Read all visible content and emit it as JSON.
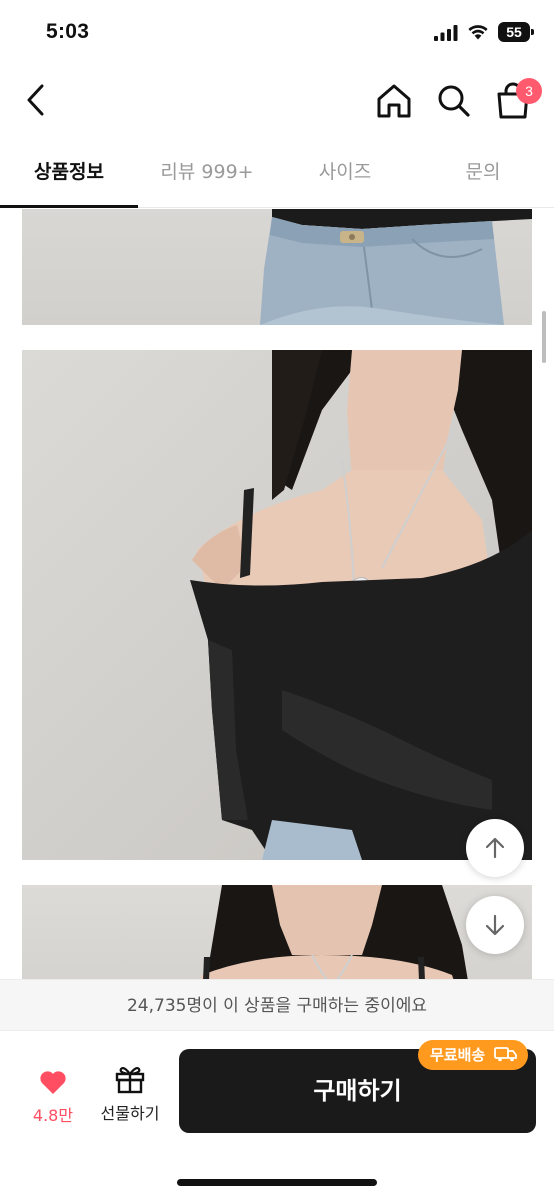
{
  "status_bar": {
    "time": "5:03",
    "battery": "55"
  },
  "header": {
    "back_icon": "chevron-left-icon",
    "home_icon": "home-icon",
    "search_icon": "search-icon",
    "cart_icon": "shopping-bag-icon",
    "cart_badge": "3",
    "badge_color": "#ff5a6e"
  },
  "tabs": [
    {
      "label": "상품정보",
      "active": true
    },
    {
      "label": "리뷰 999+",
      "active": false
    },
    {
      "label": "사이즈",
      "active": false
    },
    {
      "label": "문의",
      "active": false
    }
  ],
  "content": {
    "photos": [
      "product-photo-jeans-detail",
      "product-photo-off-shoulder-top",
      "product-photo-model"
    ],
    "scroll_up_icon": "arrow-up-icon",
    "scroll_down_icon": "arrow-down-icon"
  },
  "purchase_counter": "24,735명이 이 상품을 구매하는 중이에요",
  "bottom_bar": {
    "like_icon": "heart-icon",
    "like_count": "4.8만",
    "like_color": "#ff4d61",
    "gift_icon": "gift-icon",
    "gift_label": "선물하기",
    "buy_label": "구매하기",
    "shipping_badge": "무료배송",
    "shipping_icon": "truck-icon",
    "shipping_color": "#ff9a1f"
  }
}
